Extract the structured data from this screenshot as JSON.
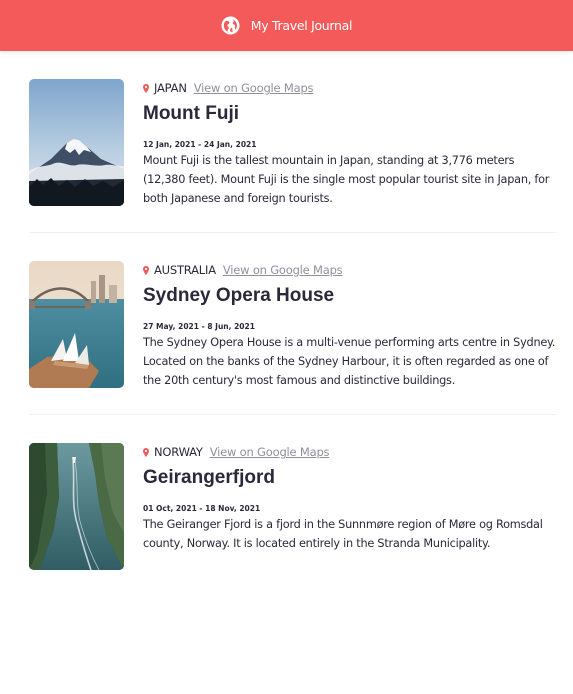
{
  "header": {
    "title": "My Travel Journal",
    "icon": "globe-icon",
    "bg_color": "#f55a5a"
  },
  "entries": [
    {
      "country": "JAPAN",
      "maps_label": "View on Google Maps",
      "title": "Mount Fuji",
      "dates": "12 Jan, 2021 - 24 Jan, 2021",
      "description": "Mount Fuji is the tallest mountain in Japan, standing at 3,776 meters (12,380 feet). Mount Fuji is the single most popular tourist site in Japan, for both Japanese and foreign tourists."
    },
    {
      "country": "AUSTRALIA",
      "maps_label": "View on Google Maps",
      "title": "Sydney Opera House",
      "dates": "27 May, 2021 - 8 Jun, 2021",
      "description": "The Sydney Opera House is a multi-venue performing arts centre in Sydney. Located on the banks of the Sydney Harbour, it is often regarded as one of the 20th century's most famous and distinctive buildings."
    },
    {
      "country": "NORWAY",
      "maps_label": "View on Google Maps",
      "title": "Geirangerfjord",
      "dates": "01 Oct, 2021 - 18 Nov, 2021",
      "description": "The Geiranger Fjord is a fjord in the Sunnmøre region of Møre og Romsdal county, Norway. It is located entirely in the Stranda Municipality."
    }
  ]
}
